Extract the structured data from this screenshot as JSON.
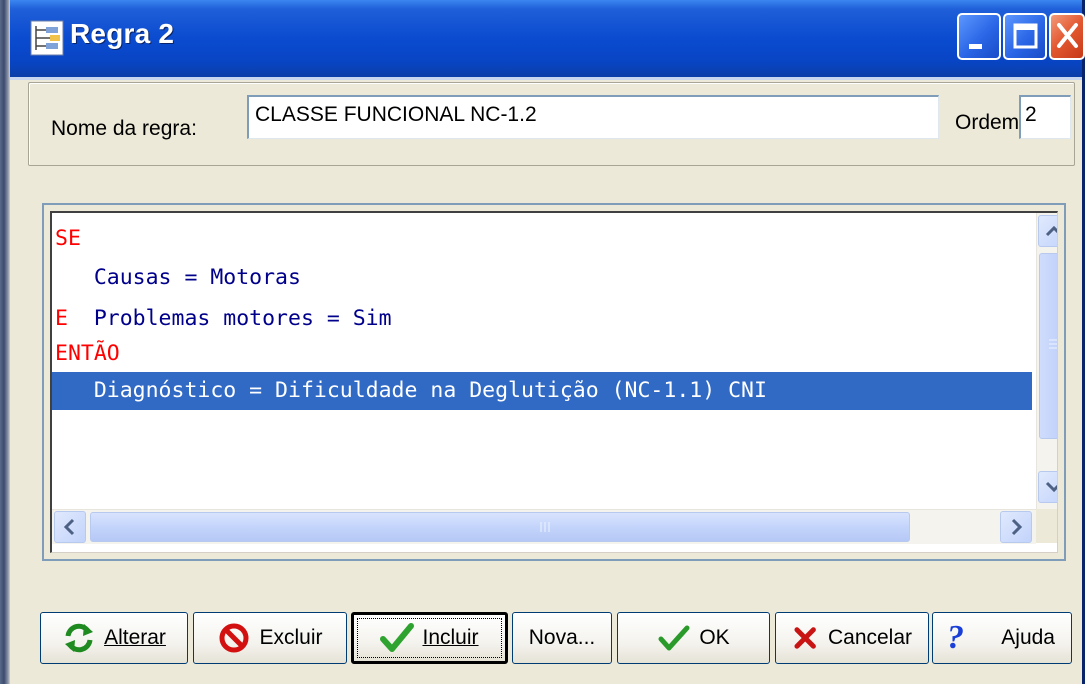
{
  "window": {
    "title": "Regra 2"
  },
  "rule": {
    "name_label": "Nome da regra:",
    "name_value": "CLASSE FUNCIONAL NC-1.2",
    "order_label": "Ordem:",
    "order_value": "2"
  },
  "code": {
    "lines": [
      {
        "keyword": "SE",
        "body": ""
      },
      {
        "keyword": " ",
        "body": "  Causas = Motoras"
      },
      {
        "keyword": "E",
        "body": "  Problemas motores = Sim"
      },
      {
        "keyword": "ENTÃO",
        "body": ""
      },
      {
        "keyword": " ",
        "body": "  Diagnóstico = Dificuldade na Deglutição (NC-1.1) CNI"
      }
    ],
    "selected_line": 4
  },
  "buttons": {
    "alterar": "Alterar",
    "excluir": "Excluir",
    "incluir": "Incluir",
    "nova": "Nova...",
    "ok": "OK",
    "cancelar": "Cancelar",
    "ajuda": "Ajuda"
  },
  "colors": {
    "keyword": "#ff0000",
    "body_text": "#00008b",
    "selection": "#316ac5",
    "titlebar": "#0a4bd0"
  }
}
